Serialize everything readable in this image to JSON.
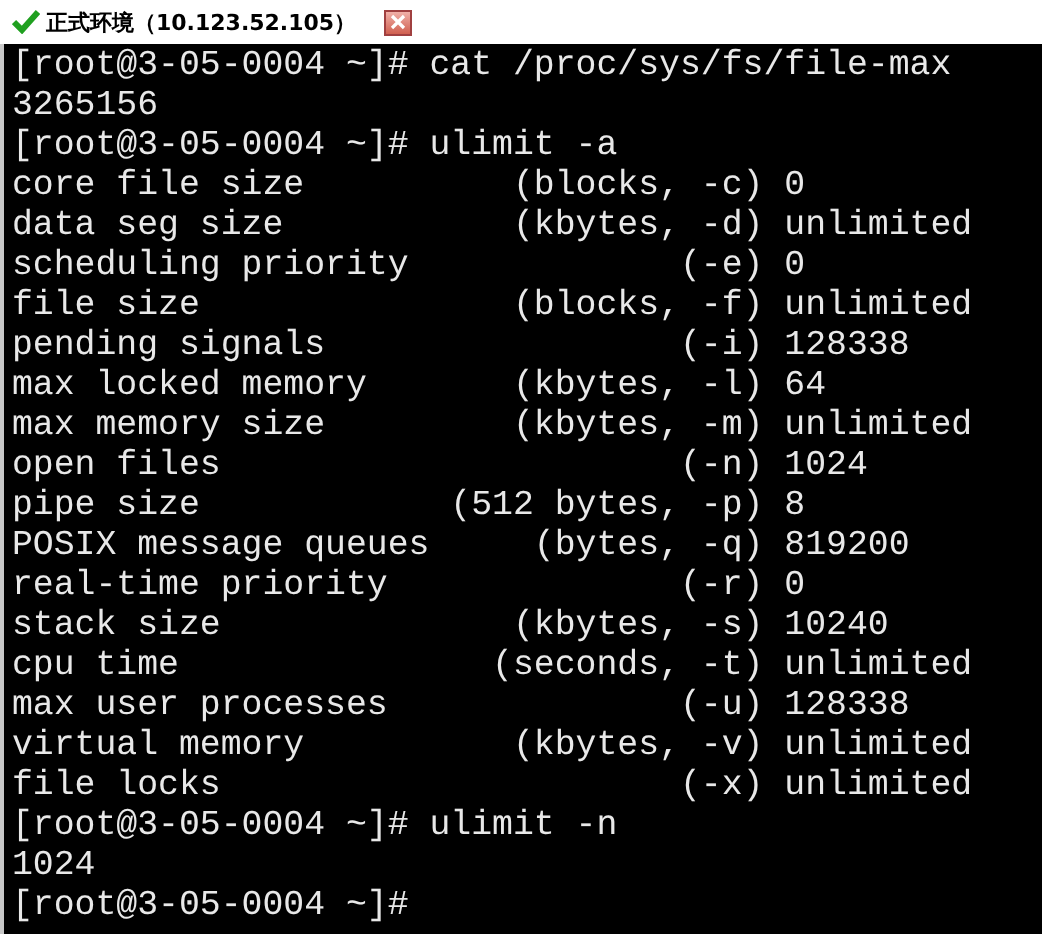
{
  "tab": {
    "title": "正式环境（10.123.52.105）",
    "connected": true
  },
  "terminal": {
    "lines": [
      "[root@3-05-0004 ~]# cat /proc/sys/fs/file-max",
      "3265156",
      "[root@3-05-0004 ~]# ulimit -a",
      "core file size          (blocks, -c) 0",
      "data seg size           (kbytes, -d) unlimited",
      "scheduling priority             (-e) 0",
      "file size               (blocks, -f) unlimited",
      "pending signals                 (-i) 128338",
      "max locked memory       (kbytes, -l) 64",
      "max memory size         (kbytes, -m) unlimited",
      "open files                      (-n) 1024",
      "pipe size            (512 bytes, -p) 8",
      "POSIX message queues     (bytes, -q) 819200",
      "real-time priority              (-r) 0",
      "stack size              (kbytes, -s) 10240",
      "cpu time               (seconds, -t) unlimited",
      "max user processes              (-u) 128338",
      "virtual memory          (kbytes, -v) unlimited",
      "file locks                      (-x) unlimited",
      "[root@3-05-0004 ~]# ulimit -n",
      "1024",
      "[root@3-05-0004 ~]#"
    ]
  }
}
